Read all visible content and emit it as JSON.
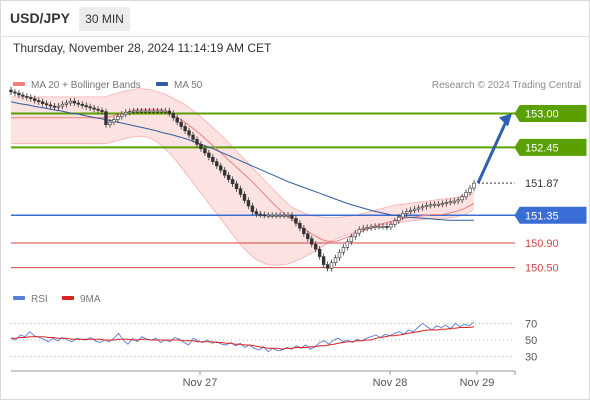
{
  "header": {
    "symbol": "USD/JPY",
    "timeframe": "30 MIN",
    "datetime": "Thursday, November 28, 2024 11:14:19 AM CET"
  },
  "legend": {
    "ma20": "MA 20 + Bollinger Bands",
    "ma50": "MA 50",
    "credit": "Research © 2024 Trading Central"
  },
  "rsi_legend": {
    "rsi": "RSI",
    "ma9": "9MA"
  },
  "colors": {
    "ma20": "#f07e7e",
    "ma50": "#2e5c9e",
    "bollinger_fill": "#fde2e2",
    "resistance": "#5aa000",
    "support_blue": "#3a6ed6",
    "support_red": "#d44444",
    "rsi": "#5a7ed6",
    "rsi_ma": "#dd2222",
    "arrow": "#2e5fb0"
  },
  "chart_data": [
    {
      "type": "candlestick",
      "title": "USD/JPY",
      "timeframe": "30 MIN",
      "x_ticks": [
        "Nov 27",
        "Nov 28",
        "Nov 29"
      ],
      "ylim": [
        150.3,
        153.3
      ],
      "levels": [
        {
          "value": 153.0,
          "label": "153.00",
          "kind": "resistance"
        },
        {
          "value": 152.45,
          "label": "152.45",
          "kind": "resistance"
        },
        {
          "value": 151.87,
          "label": "151.87",
          "kind": "last-price"
        },
        {
          "value": 151.35,
          "label": "151.35",
          "kind": "pivot"
        },
        {
          "value": 150.9,
          "label": "150.90",
          "kind": "support"
        },
        {
          "value": 150.5,
          "label": "150.50",
          "kind": "support"
        }
      ],
      "close": [
        153.35,
        153.33,
        153.3,
        153.28,
        153.26,
        153.24,
        153.21,
        153.19,
        153.16,
        153.14,
        153.12,
        153.1,
        153.12,
        153.15,
        153.17,
        153.2,
        153.17,
        153.15,
        153.13,
        153.11,
        153.09,
        153.07,
        153.05,
        153.03,
        152.82,
        152.86,
        152.9,
        152.95,
        152.99,
        153.02,
        153.03,
        153.04,
        153.04,
        153.04,
        153.04,
        153.04,
        153.04,
        153.04,
        153.04,
        153.04,
        153.0,
        152.93,
        152.86,
        152.79,
        152.72,
        152.65,
        152.58,
        152.5,
        152.43,
        152.36,
        152.29,
        152.22,
        152.15,
        152.08,
        152.0,
        151.93,
        151.86,
        151.78,
        151.69,
        151.59,
        151.5,
        151.41,
        151.37,
        151.36,
        151.35,
        151.35,
        151.35,
        151.35,
        151.35,
        151.35,
        151.35,
        151.3,
        151.22,
        151.14,
        151.05,
        150.97,
        150.88,
        150.8,
        150.68,
        150.55,
        150.49,
        150.58,
        150.66,
        150.75,
        150.83,
        150.92,
        151.0,
        151.06,
        151.12,
        151.14,
        151.15,
        151.16,
        151.17,
        151.17,
        151.17,
        151.16,
        151.2,
        151.26,
        151.32,
        151.38,
        151.41,
        151.43,
        151.45,
        151.47,
        151.49,
        151.51,
        151.52,
        151.53,
        151.53,
        151.54,
        151.56,
        151.57,
        151.58,
        151.6,
        151.65,
        151.72,
        151.79,
        151.87
      ],
      "ma20": [
        152.93,
        152.93,
        152.93,
        152.93,
        152.93,
        152.93,
        152.93,
        152.93,
        152.93,
        152.93,
        152.93,
        152.93,
        152.93,
        152.93,
        152.93,
        152.93,
        152.93,
        152.93,
        152.93,
        152.93,
        152.93,
        152.95,
        152.97,
        152.99,
        153.01,
        153.03,
        153.05,
        153.06,
        153.06,
        153.06,
        153.06,
        153.06,
        153.06,
        153.02,
        152.98,
        152.94,
        152.9,
        152.85,
        152.79,
        152.73,
        152.67,
        152.6,
        152.53,
        152.46,
        152.39,
        152.32,
        152.25,
        152.18,
        152.11,
        152.04,
        151.97,
        151.9,
        151.82,
        151.74,
        151.66,
        151.58,
        151.5,
        151.43,
        151.37,
        151.31,
        151.25,
        151.19,
        151.13,
        151.08,
        151.03,
        150.99,
        150.95,
        150.93,
        150.93,
        150.93,
        150.96,
        150.99,
        151.02,
        151.05,
        151.08,
        151.11,
        151.14,
        151.17,
        151.2,
        151.22,
        151.24,
        151.26,
        151.28,
        151.3,
        151.31,
        151.32,
        151.33,
        151.34,
        151.35,
        151.36,
        151.36,
        151.36,
        151.37,
        151.39,
        151.41,
        151.43,
        151.46,
        151.5,
        151.54
      ],
      "ma50": [
        153.19,
        153.16,
        153.14,
        153.11,
        153.09,
        153.06,
        153.04,
        153.01,
        152.99,
        152.96,
        152.93,
        152.91,
        152.88,
        152.85,
        152.82,
        152.79,
        152.76,
        152.73,
        152.69,
        152.66,
        152.62,
        152.58,
        152.53,
        152.48,
        152.43,
        152.37,
        152.31,
        152.25,
        152.19,
        152.13,
        152.07,
        152.01,
        151.95,
        151.89,
        151.84,
        151.79,
        151.74,
        151.69,
        151.64,
        151.59,
        151.54,
        151.5,
        151.46,
        151.42,
        151.39,
        151.36,
        151.34,
        151.32,
        151.31,
        151.3,
        151.29,
        151.28,
        151.27,
        151.27,
        151.27,
        151.27
      ],
      "bollinger_upper": [
        153.27,
        153.27,
        153.27,
        153.27,
        153.27,
        153.27,
        153.27,
        153.27,
        153.27,
        153.27,
        153.27,
        153.27,
        153.27,
        153.27,
        153.27,
        153.27,
        153.27,
        153.27,
        153.27,
        153.27,
        153.27,
        153.3,
        153.32,
        153.34,
        153.36,
        153.38,
        153.39,
        153.4,
        153.4,
        153.39,
        153.38,
        153.35,
        153.33,
        153.3,
        153.26,
        153.22,
        153.18,
        153.13,
        153.08,
        153.02,
        152.96,
        152.89,
        152.82,
        152.75,
        152.68,
        152.61,
        152.53,
        152.45,
        152.37,
        152.29,
        152.21,
        152.13,
        152.05,
        151.97,
        151.89,
        151.81,
        151.73,
        151.65,
        151.58,
        151.51,
        151.46,
        151.42,
        151.39,
        151.36,
        151.34,
        151.33,
        151.32,
        151.31,
        151.31,
        151.31,
        151.32,
        151.33,
        151.34,
        151.35,
        151.37,
        151.39,
        151.41,
        151.43,
        151.45,
        151.47,
        151.49,
        151.51,
        151.52,
        151.53,
        151.54,
        151.55,
        151.56,
        151.57,
        151.58,
        151.59,
        151.6,
        151.61,
        151.62,
        151.63,
        151.64,
        151.65,
        151.67,
        151.69,
        151.72
      ],
      "bollinger_lower": [
        152.51,
        152.51,
        152.51,
        152.51,
        152.51,
        152.51,
        152.51,
        152.51,
        152.51,
        152.51,
        152.51,
        152.51,
        152.51,
        152.51,
        152.51,
        152.51,
        152.51,
        152.51,
        152.51,
        152.51,
        152.51,
        152.53,
        152.55,
        152.57,
        152.59,
        152.61,
        152.62,
        152.63,
        152.63,
        152.61,
        152.58,
        152.53,
        152.47,
        152.4,
        152.32,
        152.23,
        152.13,
        152.03,
        151.93,
        151.83,
        151.73,
        151.63,
        151.53,
        151.43,
        151.33,
        151.23,
        151.13,
        151.03,
        150.93,
        150.84,
        150.76,
        150.69,
        150.63,
        150.59,
        150.56,
        150.54,
        150.54,
        150.54,
        150.55,
        150.57,
        150.6,
        150.63,
        150.67,
        150.71,
        150.75,
        150.8,
        150.85,
        150.89,
        150.93,
        150.97,
        151.0,
        151.03,
        151.06,
        151.09,
        151.12,
        151.14,
        151.16,
        151.18,
        151.19,
        151.2,
        151.21,
        151.22,
        151.23,
        151.24,
        151.25,
        151.26,
        151.27,
        151.28,
        151.29,
        151.3,
        151.3,
        151.3,
        151.3,
        151.31,
        151.32,
        151.34,
        151.36,
        151.4,
        151.45
      ]
    },
    {
      "type": "line",
      "title": "RSI",
      "series": [
        {
          "name": "RSI",
          "values": [
            52,
            50,
            56,
            54,
            60,
            55,
            53,
            51,
            48,
            52,
            49,
            53,
            50,
            48,
            52,
            51,
            50,
            53,
            49,
            47,
            50,
            48,
            52,
            58,
            50,
            45,
            52,
            48,
            54,
            51,
            50,
            52,
            47,
            50,
            48,
            53,
            51,
            47,
            44,
            52,
            49,
            47,
            50,
            46,
            48,
            45,
            44,
            47,
            43,
            46,
            41,
            44,
            40,
            38,
            42,
            36,
            40,
            37,
            38,
            41,
            39,
            43,
            40,
            44,
            39,
            42,
            47,
            49,
            45,
            50,
            52,
            48,
            50,
            47,
            51,
            49,
            52,
            54,
            56,
            53,
            57,
            55,
            58,
            60,
            57,
            62,
            60,
            65,
            70,
            66,
            62,
            67,
            65,
            68,
            63,
            70,
            66,
            69,
            67,
            72
          ]
        },
        {
          "name": "9MA",
          "values": [
            52,
            52,
            53,
            53,
            54,
            54,
            54,
            54,
            53,
            53,
            52,
            52,
            52,
            51,
            51,
            51,
            51,
            51,
            51,
            51,
            50,
            50,
            50,
            51,
            51,
            51,
            50,
            50,
            51,
            51,
            50,
            50,
            50,
            50,
            50,
            50,
            50,
            49,
            49,
            49,
            48,
            48,
            48,
            48,
            47,
            47,
            46,
            46,
            45,
            45,
            44,
            44,
            43,
            42,
            41,
            40,
            40,
            40,
            39,
            40,
            40,
            41,
            41,
            41,
            42,
            42,
            43,
            43,
            44,
            45,
            46,
            47,
            48,
            48,
            49,
            49,
            50,
            50,
            52,
            53,
            54,
            55,
            55,
            56,
            57,
            58,
            59,
            60,
            61,
            62,
            62,
            62,
            63,
            63,
            64,
            64,
            65,
            65,
            65,
            66
          ]
        }
      ],
      "y_ticks": [
        30,
        50,
        70
      ],
      "ylim": [
        20,
        80
      ]
    }
  ]
}
